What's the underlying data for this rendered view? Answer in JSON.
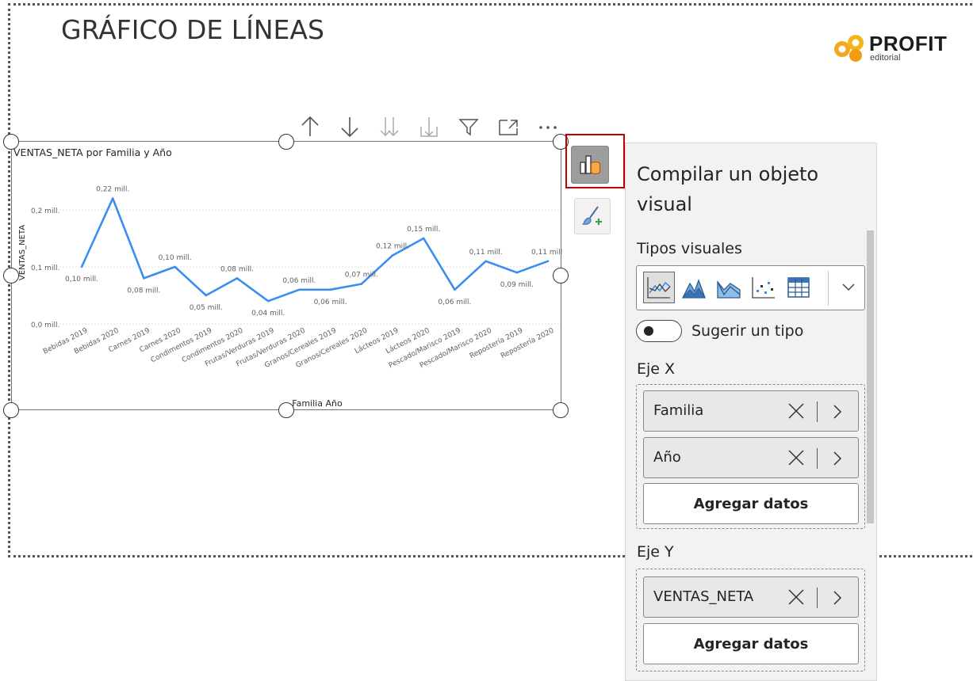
{
  "report": {
    "title": "GRÁFICO DE LÍNEAS"
  },
  "logo": {
    "name": "PROFIT",
    "subtitle": "editorial"
  },
  "visual_toolbar": {
    "icons": [
      "drill-up-icon",
      "drill-down-icon",
      "expand-next-level-icon",
      "expand-hierarchy-icon",
      "filter-icon",
      "focus-mode-icon",
      "more-options-icon"
    ]
  },
  "chart_data": {
    "type": "line",
    "title": "VENTAS_NETA por Familia y Año",
    "xlabel": "Familia Año",
    "ylabel": "VENTAS_NETA",
    "y_ticks": [
      "0,0 mill.",
      "0,1 mill.",
      "0,2 mill."
    ],
    "y_tick_values": [
      0,
      0.1,
      0.2
    ],
    "ylim": [
      0,
      0.25
    ],
    "grid": true,
    "line_color": "#3a8ef0",
    "categories": [
      "Bebidas 2019",
      "Bebidas 2020",
      "Carnes 2019",
      "Carnes 2020",
      "Condimentos 2019",
      "Condimentos 2020",
      "Frutas/Verduras 2019",
      "Frutas/Verduras 2020",
      "Granos/Cereales 2019",
      "Granos/Cereales 2020",
      "Lácteos 2019",
      "Lácteos 2020",
      "Pescado/Marisco 2019",
      "Pescado/Marisco 2020",
      "Repostería 2019",
      "Repostería 2020"
    ],
    "values": [
      0.1,
      0.22,
      0.08,
      0.1,
      0.05,
      0.08,
      0.04,
      0.06,
      0.06,
      0.07,
      0.12,
      0.15,
      0.06,
      0.11,
      0.09,
      0.11
    ],
    "data_labels": [
      "0,10 mill.",
      "0,22 mill.",
      "0,08 mill.",
      "0,10 mill.",
      "0,05 mill.",
      "0,08 mill.",
      "0,04 mill.",
      "0,06 mill.",
      "0,06 mill.",
      "0,07 mill.",
      "0,12 mill.",
      "0,15 mill.",
      "0,06 mill.",
      "0,11 mill.",
      "0,09 mill.",
      "0,11 mill."
    ],
    "label_positions": [
      "below",
      "above",
      "below",
      "above",
      "below",
      "above",
      "below",
      "above",
      "below",
      "above",
      "above",
      "above",
      "below",
      "above",
      "below",
      "above"
    ]
  },
  "pane": {
    "title": "Compilar un objeto visual",
    "visual_types_label": "Tipos visuales",
    "visual_types": [
      "line-chart-icon",
      "area-chart-icon",
      "stacked-area-chart-icon",
      "scatter-chart-icon",
      "table-icon"
    ],
    "suggest_label": "Sugerir un tipo",
    "x_axis": {
      "label": "Eje X",
      "fields": [
        "Familia",
        "Año"
      ],
      "add_label": "Agregar datos"
    },
    "y_axis": {
      "label": "Eje Y",
      "fields": [
        "VENTAS_NETA"
      ],
      "add_label": "Agregar datos"
    }
  }
}
